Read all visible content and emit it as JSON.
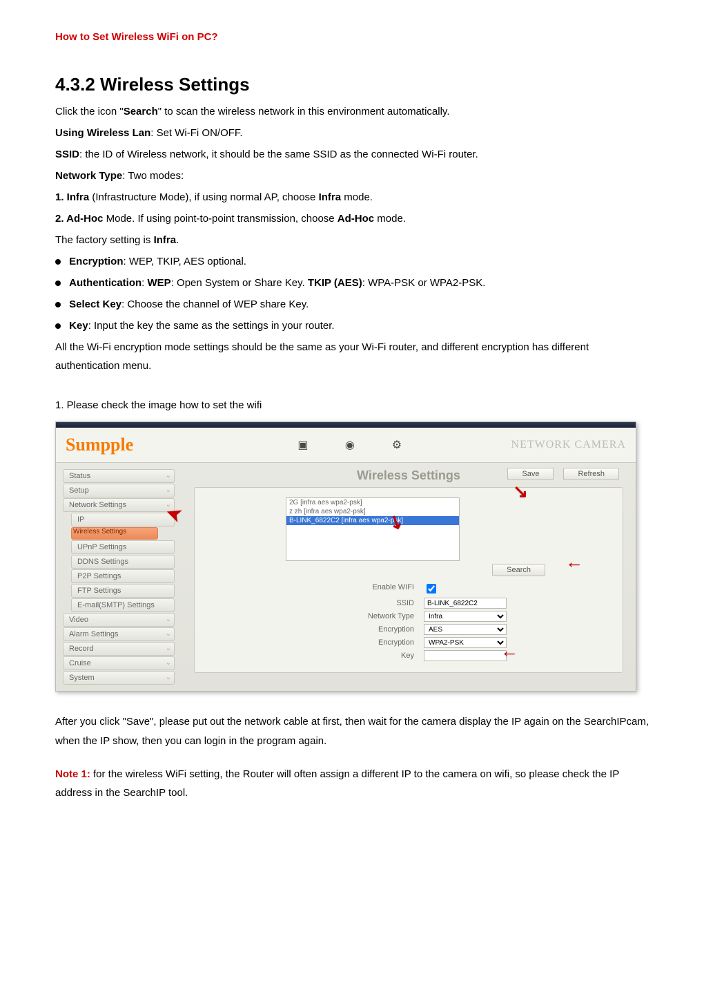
{
  "title": "How to Set Wireless WiFi on PC?",
  "heading": "4.3.2 Wireless Settings",
  "intro": {
    "line1a": "Click the icon \"",
    "line1b": "Search",
    "line1c": "\" to scan the wireless network in this environment automatically.",
    "usingLan_b": "Using Wireless Lan",
    "usingLan_t": ": Set Wi-Fi ON/OFF.",
    "ssid_b": "SSID",
    "ssid_t": ": the ID of Wireless network, it should be the same SSID as the connected Wi-Fi router.",
    "netType_b": "Network Type",
    "netType_t": ": Two modes:",
    "infra_b": "1. Infra",
    "infra_t1": " (Infrastructure Mode), if using normal AP, choose ",
    "infra_t2": "Infra",
    "infra_t3": " mode.",
    "adhoc_b": "2. Ad-Hoc",
    "adhoc_t1": " Mode. If using point-to-point transmission, choose ",
    "adhoc_t2": "Ad-Hoc",
    "adhoc_t3": " mode.",
    "factory1": "The factory setting is ",
    "factory2": "Infra",
    "factory3": "."
  },
  "bullets": {
    "enc_b": "Encryption",
    "enc_t": ": WEP, TKIP, AES optional.",
    "auth_b": "Authentication",
    "auth_t1": ": ",
    "auth_wep": "WEP",
    "auth_t2": ": Open System or Share Key. ",
    "auth_tkip": "TKIP (AES)",
    "auth_t3": ": WPA-PSK or WPA2-PSK.",
    "sel_b": "Select Key",
    "sel_t": ": Choose the channel of WEP share Key.",
    "key_b": "Key",
    "key_t": ": Input the key the same as the settings in your router."
  },
  "closing": "All the Wi-Fi encryption mode settings should be the same as your Wi-Fi router, and different encryption has different authentication menu.",
  "step1": "1. Please check the image how to set the wifi",
  "screenshot": {
    "brand": "Sumpple",
    "netCamera": "NETWORK CAMERA",
    "sidebar": {
      "status": "Status",
      "setup": "Setup",
      "network": "Network Settings",
      "ip": "IP",
      "wireless": "Wireless Settings",
      "upnp": "UPnP Settings",
      "ddns": "DDNS Settings",
      "p2p": "P2P Settings",
      "ftp": "FTP Settings",
      "smtp": "E-mail(SMTP) Settings",
      "video": "Video",
      "alarm": "Alarm Settings",
      "record": "Record",
      "cruise": "Cruise",
      "system": "System"
    },
    "panelTitle": "Wireless Settings",
    "buttons": {
      "save": "Save",
      "refresh": "Refresh",
      "search": "Search"
    },
    "scanList": {
      "0": "2G [infra aes wpa2-psk]",
      "1": "z zh [infra aes wpa2-psk]",
      "2": "B-LINK_6822C2 [infra aes wpa2-psk]"
    },
    "form": {
      "enableWifi_l": "Enable WIFI",
      "ssid_l": "SSID",
      "ssid_v": "B-LINK_6822C2",
      "netType_l": "Network Type",
      "netType_v": "Infra",
      "enc_l": "Encryption",
      "enc_v": "AES",
      "enc2_l": "Encryption",
      "enc2_v": "WPA2-PSK",
      "key_l": "Key"
    }
  },
  "after": "After you click \"Save\",  please put out the network cable at first, then wait for the camera display the IP again on the SearchIPcam,  when the IP show, then you can login in the program again.",
  "note1_label": "Note 1:",
  "note1_text": " for the wireless WiFi setting, the Router will often assign a different IP to the camera on wifi, so please check the IP address in the SearchIP tool."
}
